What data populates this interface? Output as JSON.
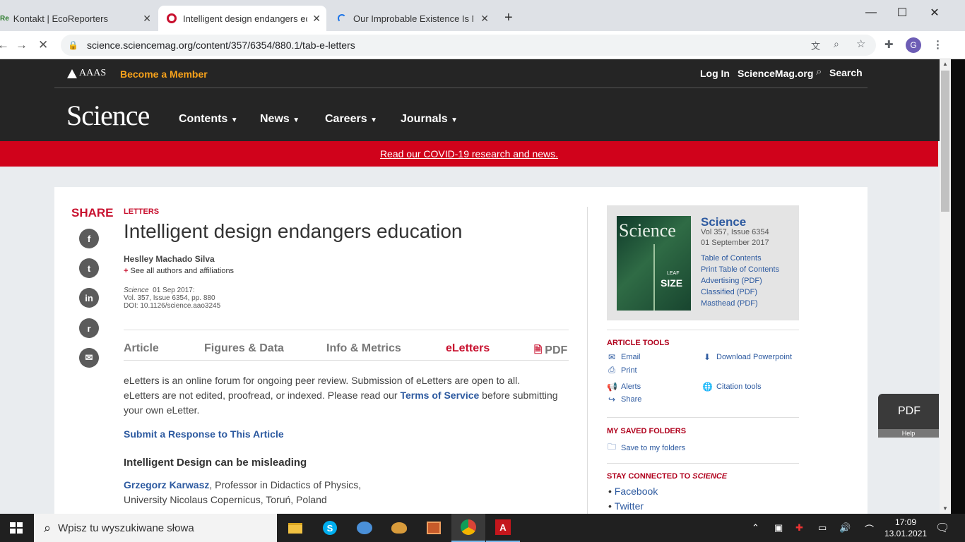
{
  "browser": {
    "tabs": [
      {
        "label": "Kontakt | EcoReporters",
        "favicon": "Re"
      },
      {
        "label": "Intelligent design endangers edu",
        "favicon": "circle"
      },
      {
        "label": "Our Improbable Existence Is No E",
        "favicon": "loading"
      }
    ],
    "new_tab": "+",
    "window_controls": {
      "minimize": "—",
      "maximize": "☐",
      "close": "✕"
    },
    "url": "science.sciencemag.org/content/357/6354/880.1/tab-e-letters",
    "avatar_letter": "G"
  },
  "site_header": {
    "aaas": "AAAS",
    "become_member": "Become a Member",
    "login": "Log In",
    "sciencemag": "ScienceMag.org",
    "search": "Search",
    "logo": "Science",
    "menu": [
      "Contents",
      "News",
      "Careers",
      "Journals"
    ]
  },
  "banner": {
    "text": "Read our COVID-19 research and news."
  },
  "share": {
    "title": "SHARE",
    "buttons": [
      "f",
      "t",
      "in",
      "r",
      "✉"
    ]
  },
  "article": {
    "category": "LETTERS",
    "title": "Intelligent design endangers education",
    "author": "Heslley Machado Silva",
    "affiliations_link": "See all authors and affiliations",
    "journal": "Science",
    "date": "01 Sep 2017:",
    "volume": "Vol. 357, Issue 6354, pp. 880",
    "doi": "DOI: 10.1126/science.aao3245",
    "tabs": [
      "Article",
      "Figures & Data",
      "Info & Metrics",
      "eLetters",
      "PDF"
    ],
    "intro_1": "eLetters is an online forum for ongoing peer review. Submission of eLetters are open to all.",
    "intro_2a": "eLetters are not edited, proofread, or indexed.  Please read our ",
    "intro_terms": "Terms of Service",
    "intro_2b": " before submitting",
    "intro_3": "your own eLetter.",
    "submit_link": "Submit a Response to This Article",
    "letter_title": "Intelligent Design can be misleading",
    "letter_author": "Grzegorz Karwasz",
    "letter_role": ", Professor in Didactics of Physics,",
    "letter_affil": "University Nicolaus Copernicus, Toruń, Poland"
  },
  "sidebar": {
    "journal_title": "Science",
    "issue": "Vol 357, Issue 6354",
    "issue_date": "01 September 2017",
    "cover_logo": "Science",
    "cover_text": "SIZE",
    "cover_small": "LEAF",
    "links": [
      "Table of Contents",
      "Print Table of Contents",
      "Advertising (PDF)",
      "Classified (PDF)",
      "Masthead (PDF)"
    ],
    "tools_title": "ARTICLE TOOLS",
    "tools": [
      "Email",
      "Download Powerpoint",
      "Print",
      "Alerts",
      "Citation tools",
      "Share"
    ],
    "folders_title": "MY SAVED FOLDERS",
    "save_folders": "Save to my folders",
    "stay_title_a": "STAY CONNECTED TO ",
    "stay_title_b": "SCIENCE",
    "social": [
      "Facebook",
      "Twitter"
    ]
  },
  "pdf_widget": {
    "label": "PDF",
    "help": "Help"
  },
  "taskbar": {
    "search_placeholder": "Wpisz tu wyszukiwane słowa",
    "time": "17:09",
    "date": "13.01.2021"
  }
}
